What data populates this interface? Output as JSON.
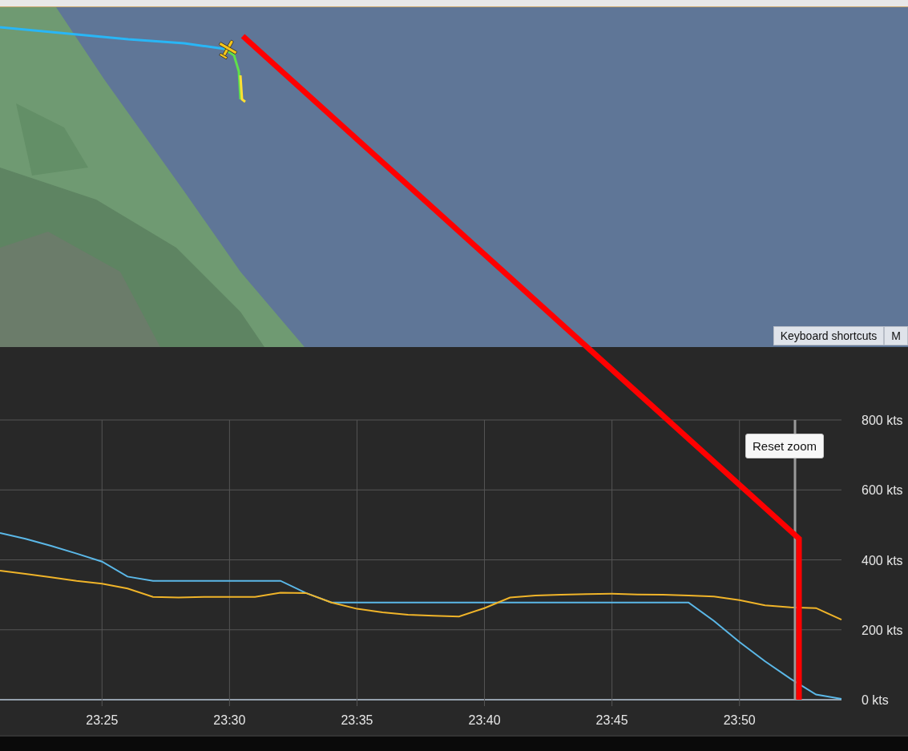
{
  "map": {
    "kind": "picture",
    "controls": [
      {
        "label": "Keyboard shortcuts"
      },
      {
        "label": "M"
      }
    ]
  },
  "chart": {
    "reset_button": "Reset zoom",
    "chart_data": {
      "type": "line",
      "categories": [
        null,
        null,
        null,
        null,
        "23:25",
        null,
        null,
        null,
        null,
        "23:30",
        null,
        null,
        null,
        null,
        "23:35",
        null,
        null,
        null,
        null,
        "23:40",
        null,
        null,
        null,
        null,
        "23:45",
        null,
        null,
        null,
        null,
        "23:50",
        null,
        null,
        null,
        null
      ],
      "series": [
        {
          "color": "#5bb8e8",
          "values": [
            477,
            460,
            440,
            418,
            395,
            352,
            340,
            340,
            340,
            340,
            340,
            340,
            305,
            278,
            278,
            278,
            278,
            278,
            278,
            278,
            278,
            278,
            278,
            278,
            278,
            278,
            278,
            278,
            225,
            165,
            110,
            60,
            15,
            2
          ]
        },
        {
          "color": "#f0b429",
          "values": [
            369,
            360,
            350,
            340,
            332,
            318,
            294,
            292,
            294,
            294,
            294,
            306,
            305,
            278,
            260,
            250,
            243,
            240,
            238,
            262,
            292,
            298,
            300,
            302,
            303,
            301,
            300,
            298,
            295,
            285,
            270,
            264,
            262,
            229
          ]
        }
      ],
      "grid": true,
      "ylim": [
        0,
        800
      ],
      "yticks": [
        {
          "value": 0,
          "label": "0 kts"
        },
        {
          "value": 200,
          "label": "200 kts"
        },
        {
          "value": 400,
          "label": "400 kts"
        },
        {
          "value": 600,
          "label": "600 kts"
        },
        {
          "value": 800,
          "label": "800 kts"
        }
      ]
    }
  }
}
